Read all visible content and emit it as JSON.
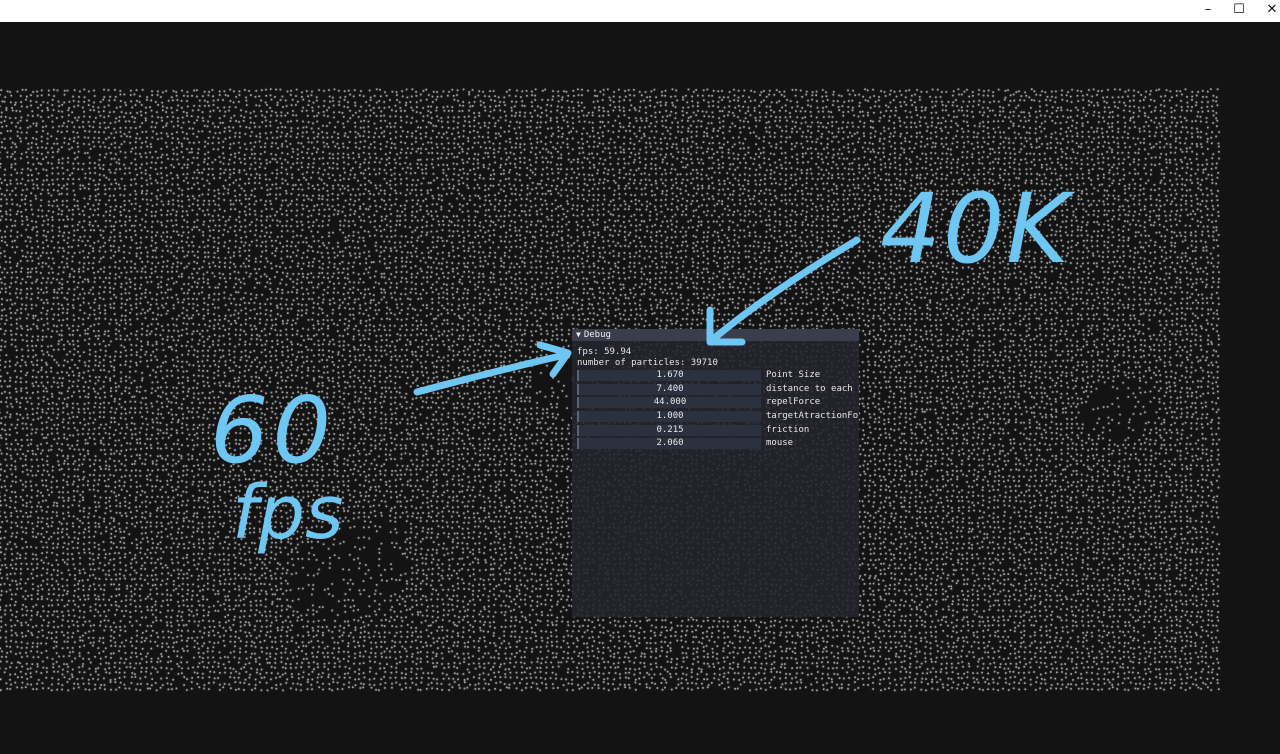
{
  "window": {
    "controls": {
      "minimize": "–",
      "maximize": "☐",
      "close": "✕"
    }
  },
  "debug": {
    "title": "Debug",
    "fps_text": "fps: 59.94",
    "particles_text": "number of particles: 39710",
    "sliders": [
      {
        "value": "1.670",
        "label": "Point Size"
      },
      {
        "value": "7.400",
        "label": "distance to each o"
      },
      {
        "value": "44.000",
        "label": "repelForce"
      },
      {
        "value": "1.000",
        "label": "targetAtractionFor"
      },
      {
        "value": "0.215",
        "label": "friction"
      },
      {
        "value": "2.060",
        "label": "mouse"
      }
    ]
  },
  "annotations": {
    "color": "#6ec6f2",
    "note_fps_number": "60",
    "note_fps_unit": "fps",
    "note_particles": "40K"
  },
  "colors": {
    "background": "#131313",
    "particle": "#e8e8e8",
    "debug_bg": "#24242e",
    "debug_title": "#3a3d4c"
  }
}
